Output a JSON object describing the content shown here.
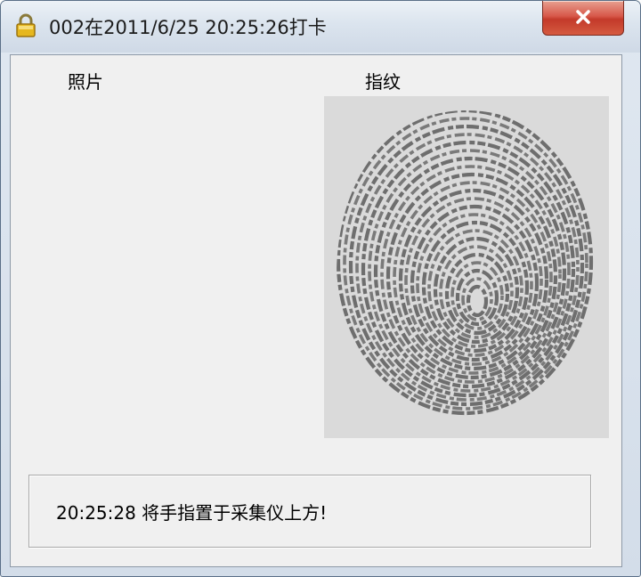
{
  "window": {
    "title": "002在2011/6/25 20:25:26打卡",
    "lock_icon": "lock-icon",
    "close_icon": "close-icon"
  },
  "labels": {
    "photo": "照片",
    "fingerprint": "指纹"
  },
  "fingerprint_image": "fingerprint-icon",
  "status": {
    "message": "20:25:28 将手指置于采集仪上方!"
  }
}
